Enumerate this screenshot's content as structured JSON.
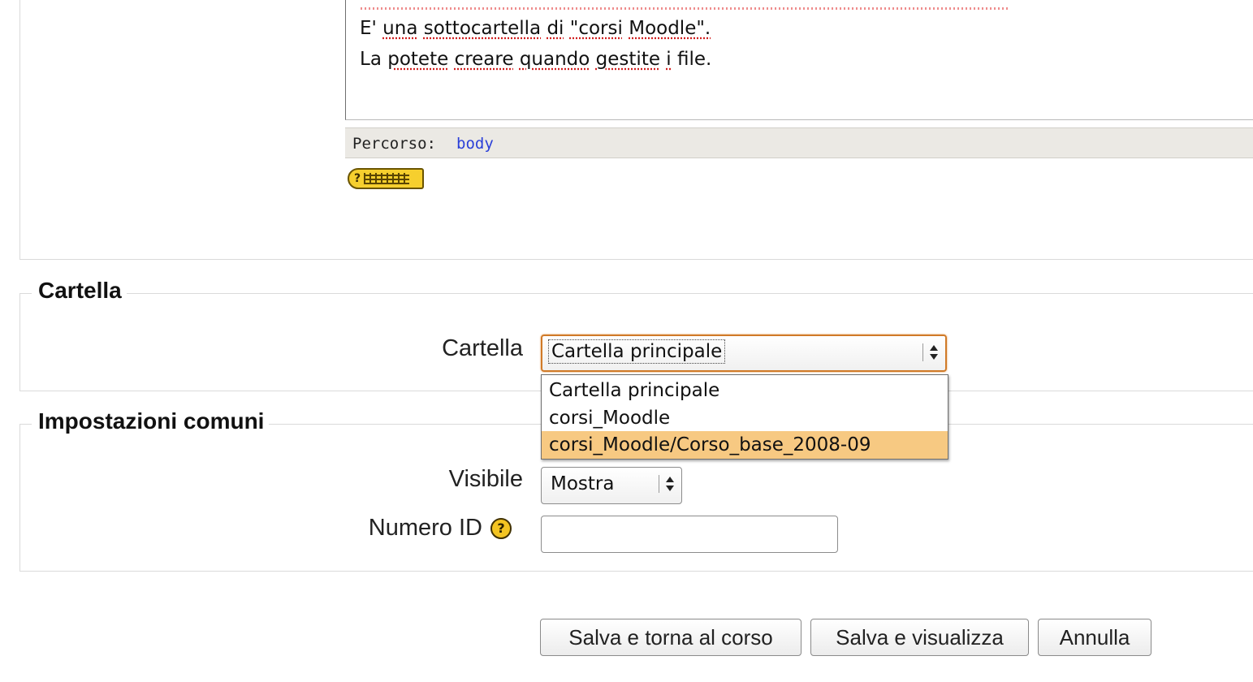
{
  "editor": {
    "line1_parts": [
      "E'",
      "una",
      "sottocartella",
      "di",
      "\"corsi",
      "Moodle\"."
    ],
    "line2_parts": [
      "La",
      "potete",
      "creare",
      "quando",
      "gestite",
      "i",
      "file."
    ],
    "path_label": "Percorso:",
    "path_value": "body"
  },
  "section_folder": {
    "legend": "Cartella",
    "field_label": "Cartella",
    "selected_value": "Cartella principale",
    "options": [
      "Cartella principale",
      "corsi_Moodle",
      "corsi_Moodle/Corso_base_2008-09"
    ],
    "highlighted_option": "corsi_Moodle/Corso_base_2008-09"
  },
  "section_common": {
    "legend": "Impostazioni comuni",
    "visible_label": "Visibile",
    "visible_value": "Mostra",
    "id_label": "Numero ID",
    "id_value": "",
    "help_glyph": "?"
  },
  "buttons": {
    "save_return": "Salva e torna al corso",
    "save_view": "Salva e visualizza",
    "cancel": "Annulla"
  },
  "icons": {
    "keyboard_help": "keyboard-help-icon",
    "help": "help-icon"
  },
  "colors": {
    "focus_border": "#d07a28",
    "highlight_option": "#f7c982",
    "path_link": "#2a3fd8",
    "help_icon": "#f3c422"
  }
}
